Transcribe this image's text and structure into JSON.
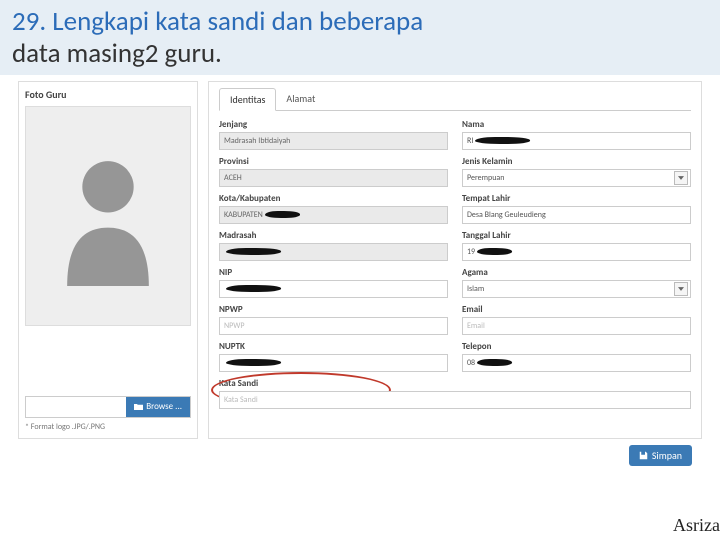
{
  "slide": {
    "title_line1": "29. Lengkapi kata sandi dan beberapa",
    "title_line2": "data masing2 guru."
  },
  "photo_panel": {
    "title": "Foto Guru",
    "browse_label": "Browse ...",
    "format_note": "* Format logo .JPG/.PNG"
  },
  "tabs": {
    "identitas": "Identitas",
    "alamat": "Alamat"
  },
  "form": {
    "jenjang": {
      "label": "Jenjang",
      "value": "Madrasah Ibtidaiyah"
    },
    "nama": {
      "label": "Nama",
      "value": "RI"
    },
    "provinsi": {
      "label": "Provinsi",
      "value": "ACEH"
    },
    "jk": {
      "label": "Jenis Kelamin",
      "value": "Perempuan"
    },
    "kota": {
      "label": "Kota/Kabupaten",
      "value": "KABUPATEN"
    },
    "tempat": {
      "label": "Tempat Lahir",
      "value": "Desa Blang Geuleudieng"
    },
    "madrasah": {
      "label": "Madrasah",
      "value": ""
    },
    "tgl": {
      "label": "Tanggal Lahir",
      "value": "19"
    },
    "nip": {
      "label": "NIP",
      "value": ""
    },
    "agama": {
      "label": "Agama",
      "value": "Islam"
    },
    "npwp": {
      "label": "NPWP",
      "placeholder": "NPWP"
    },
    "email": {
      "label": "Email",
      "placeholder": "Email"
    },
    "nuptk": {
      "label": "NUPTK",
      "value": ""
    },
    "telepon": {
      "label": "Telepon",
      "value": "08"
    },
    "sandi": {
      "label": "Kata Sandi",
      "placeholder": "Kata Sandi"
    }
  },
  "buttons": {
    "simpan": "Simpan"
  },
  "author": "Asriza"
}
